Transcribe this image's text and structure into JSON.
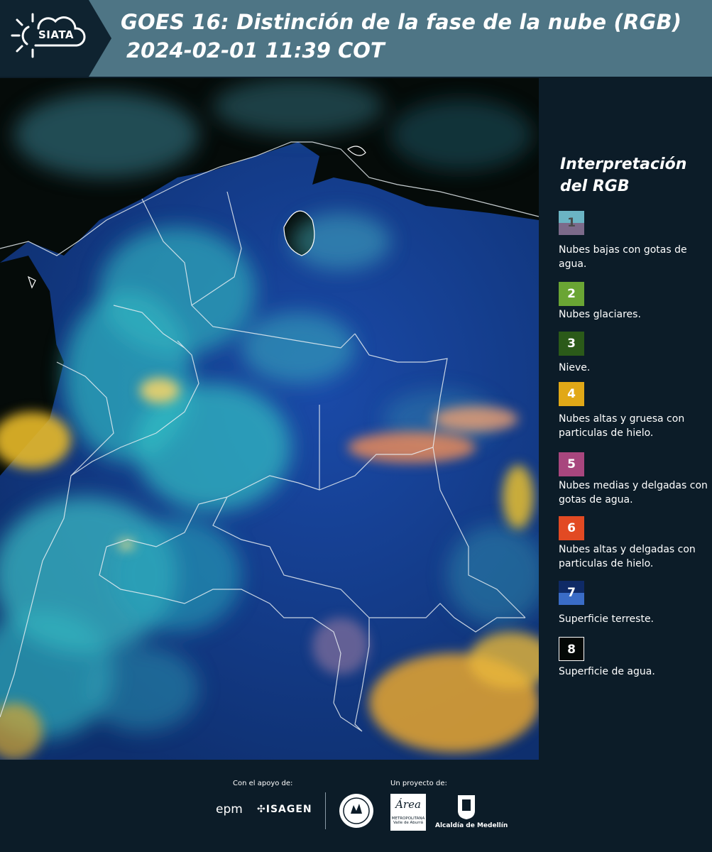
{
  "header": {
    "logo_text": "SIATA",
    "title_line1": "GOES 16: Distinción de la fase de la nube (RGB)",
    "title_line2": "2024-02-01 11:39 COT"
  },
  "legend": {
    "title_line1": "Interpretación",
    "title_line2": "del RGB",
    "items": [
      {
        "number": "1",
        "label": "Nubes bajas con gotas de agua.",
        "color_top": "#6bb4c4",
        "color_bottom": "#7c6a8a"
      },
      {
        "number": "2",
        "label": "Nubes glaciares.",
        "color_top": "#6aa534",
        "color_bottom": "#6aa534"
      },
      {
        "number": "3",
        "label": "Nieve.",
        "color_top": "#2b5a19",
        "color_bottom": "#2b5a19"
      },
      {
        "number": "4",
        "label": "Nubes altas y gruesa con particulas de hielo.",
        "color_top": "#e1a817",
        "color_bottom": "#e1a817"
      },
      {
        "number": "5",
        "label": "Nubes medias y delgadas con gotas de agua.",
        "color_top": "#a8467e",
        "color_bottom": "#a8467e"
      },
      {
        "number": "6",
        "label": "Nubes altas y delgadas con particulas de hielo.",
        "color_top": "#e24a23",
        "color_bottom": "#e24a23"
      },
      {
        "number": "7",
        "label": "Superficie terreste.",
        "color_top": "#0f2a66",
        "color_bottom": "#3a6cc6"
      },
      {
        "number": "8",
        "label": "Superficie de agua.",
        "color_top": "#040806",
        "color_bottom": "#040806"
      }
    ]
  },
  "footer": {
    "support_label": "Con el apoyo de:",
    "project_label": "Un proyecto de:",
    "sponsor1": "epm",
    "sponsor2": "ISAGEN",
    "partner_area": "Área",
    "partner_area_sub1": "METROPOLITANA",
    "partner_area_sub2": "Valle de Aburrá",
    "partner_alcaldia": "Alcaldía de Medellín"
  },
  "colors": {
    "header_bg": "#4e7585",
    "panel_bg": "#0c1c28",
    "land": "#163c8a",
    "water": "#040a08"
  }
}
